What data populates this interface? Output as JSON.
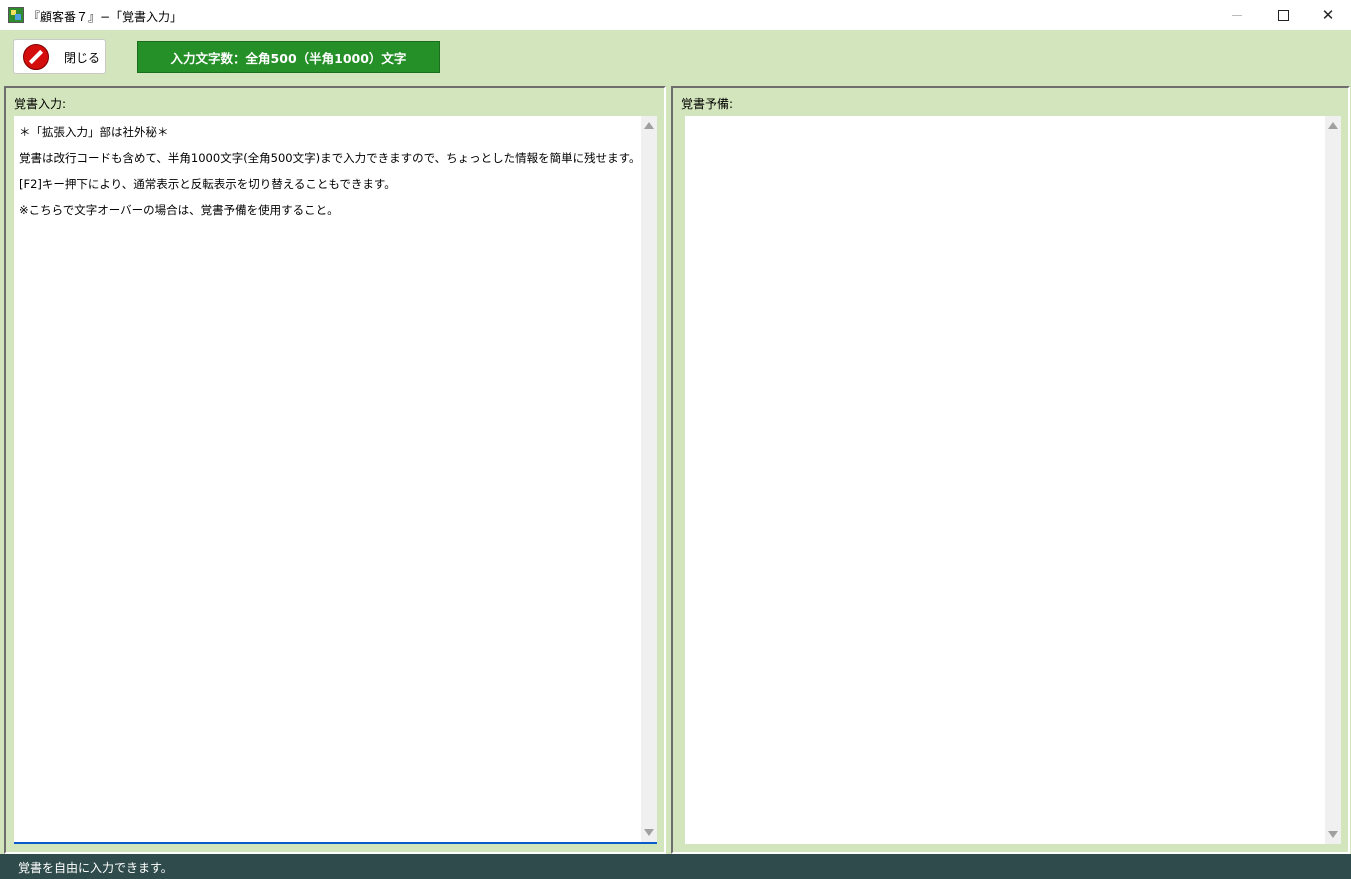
{
  "window": {
    "title": "『顧客番７』−「覚書入力」"
  },
  "toolbar": {
    "close_label": "閉じる",
    "char_limit": "入力文字数：全角500（半角1000）文字"
  },
  "memo_input": {
    "label": "覚書入力:",
    "lines": [
      "＊「拡張入力」部は社外秘＊",
      "覚書は改行コードも含めて、半角1000文字(全角500文字)まで入力できますので、ちょっとした情報を簡単に残せます。",
      "[F2]キー押下により、通常表示と反転表示を切り替えることもできます。",
      "※こちらで文字オーバーの場合は、覚書予備を使用すること。"
    ]
  },
  "memo_reserve": {
    "label": "覚書予備:",
    "lines": []
  },
  "status": {
    "text": "覚書を自由に入力できます。"
  },
  "colors": {
    "background": "#d3e5bd",
    "char_limit_bg": "#258f28",
    "status_bg": "#2f4b4b",
    "close_icon": "#d40d0d"
  }
}
